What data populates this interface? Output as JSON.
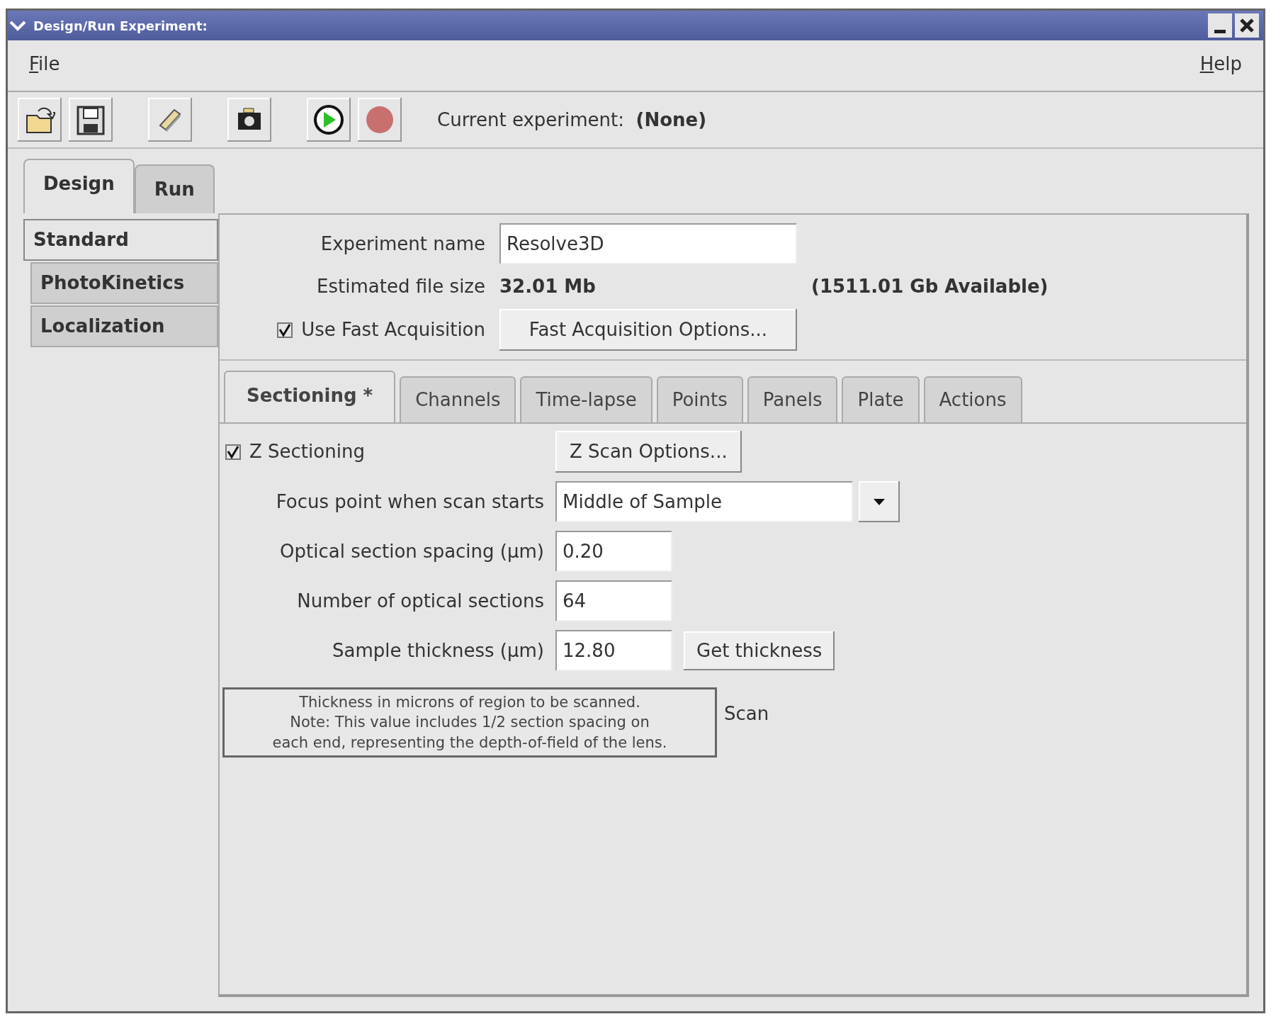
{
  "window": {
    "title": "Design/Run Experiment:"
  },
  "menu": [
    {
      "label": "File"
    },
    {
      "label": "Help"
    }
  ],
  "toolbar": [
    {
      "kind": "open"
    },
    {
      "kind": "save"
    },
    {
      "kind": "edit"
    },
    {
      "kind": "camera"
    },
    {
      "kind": "run"
    },
    {
      "kind": "stop"
    }
  ],
  "current_experiment": {
    "label": "Current experiment:",
    "value": "(None)"
  },
  "main_tabs": [
    {
      "label": "Design",
      "selected": true
    },
    {
      "label": "Run",
      "selected": false
    }
  ],
  "side_tabs": [
    {
      "label": "Standard",
      "selected": true
    },
    {
      "label": "PhotoKinetics",
      "selected": false
    },
    {
      "label": "Localization",
      "selected": false
    }
  ],
  "experiment_name": {
    "label": "Experiment name",
    "value": "Resolve3D"
  },
  "file_size": {
    "label": "Estimated file size",
    "value": "32.01 Mb",
    "available": "(1511.01 Gb Available)"
  },
  "fast_acquisition": {
    "label": "Use Fast Acquisition",
    "checked": true,
    "button": "Fast Acquisition Options..."
  },
  "sub_tabs": [
    {
      "label": "Sectioning *",
      "selected": true
    },
    {
      "label": "Channels",
      "selected": false
    },
    {
      "label": "Time-lapse",
      "selected": false
    },
    {
      "label": "Points",
      "selected": false
    },
    {
      "label": "Panels",
      "selected": false
    },
    {
      "label": "Plate",
      "selected": false
    },
    {
      "label": "Actions",
      "selected": false
    }
  ],
  "z_sectioning": {
    "label": "Z Sectioning",
    "checked": true,
    "button": "Z Scan Options..."
  },
  "focus_point": {
    "label": "Focus point when scan starts",
    "value": "Middle of Sample"
  },
  "section_spacing": {
    "label": "Optical section spacing (µm)",
    "value": "0.20"
  },
  "section_count": {
    "label": "Number of optical sections",
    "value": "64"
  },
  "thickness": {
    "label": "Sample thickness (µm)",
    "value": "12.80",
    "button": "Get thickness"
  },
  "hidden_option": {
    "label": "Scan"
  },
  "tooltip": {
    "text": "Thickness in microns of region to be scanned.\nNote: This value includes 1/2 section spacing on\neach end, representing the depth-of-field of the lens."
  }
}
